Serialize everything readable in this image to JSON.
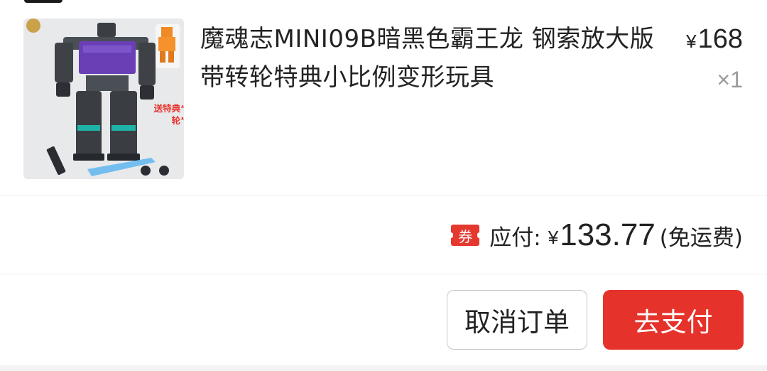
{
  "product": {
    "title": "魔魂志MINI09B暗黑色霸王龙 钢索放大版带转轮特典小比例变形玩具",
    "image_promo": "送特典“小转轮”",
    "price_currency": "¥",
    "price": "168",
    "quantity": "×1"
  },
  "payment": {
    "coupon_badge": "券",
    "label": "应付:",
    "currency": "¥",
    "amount": "133.77",
    "note": "(免运费)"
  },
  "actions": {
    "cancel_label": "取消订单",
    "pay_label": "去支付"
  },
  "colors": {
    "accent_red": "#e5322b",
    "text": "#222222",
    "muted": "#9a9a9a"
  }
}
